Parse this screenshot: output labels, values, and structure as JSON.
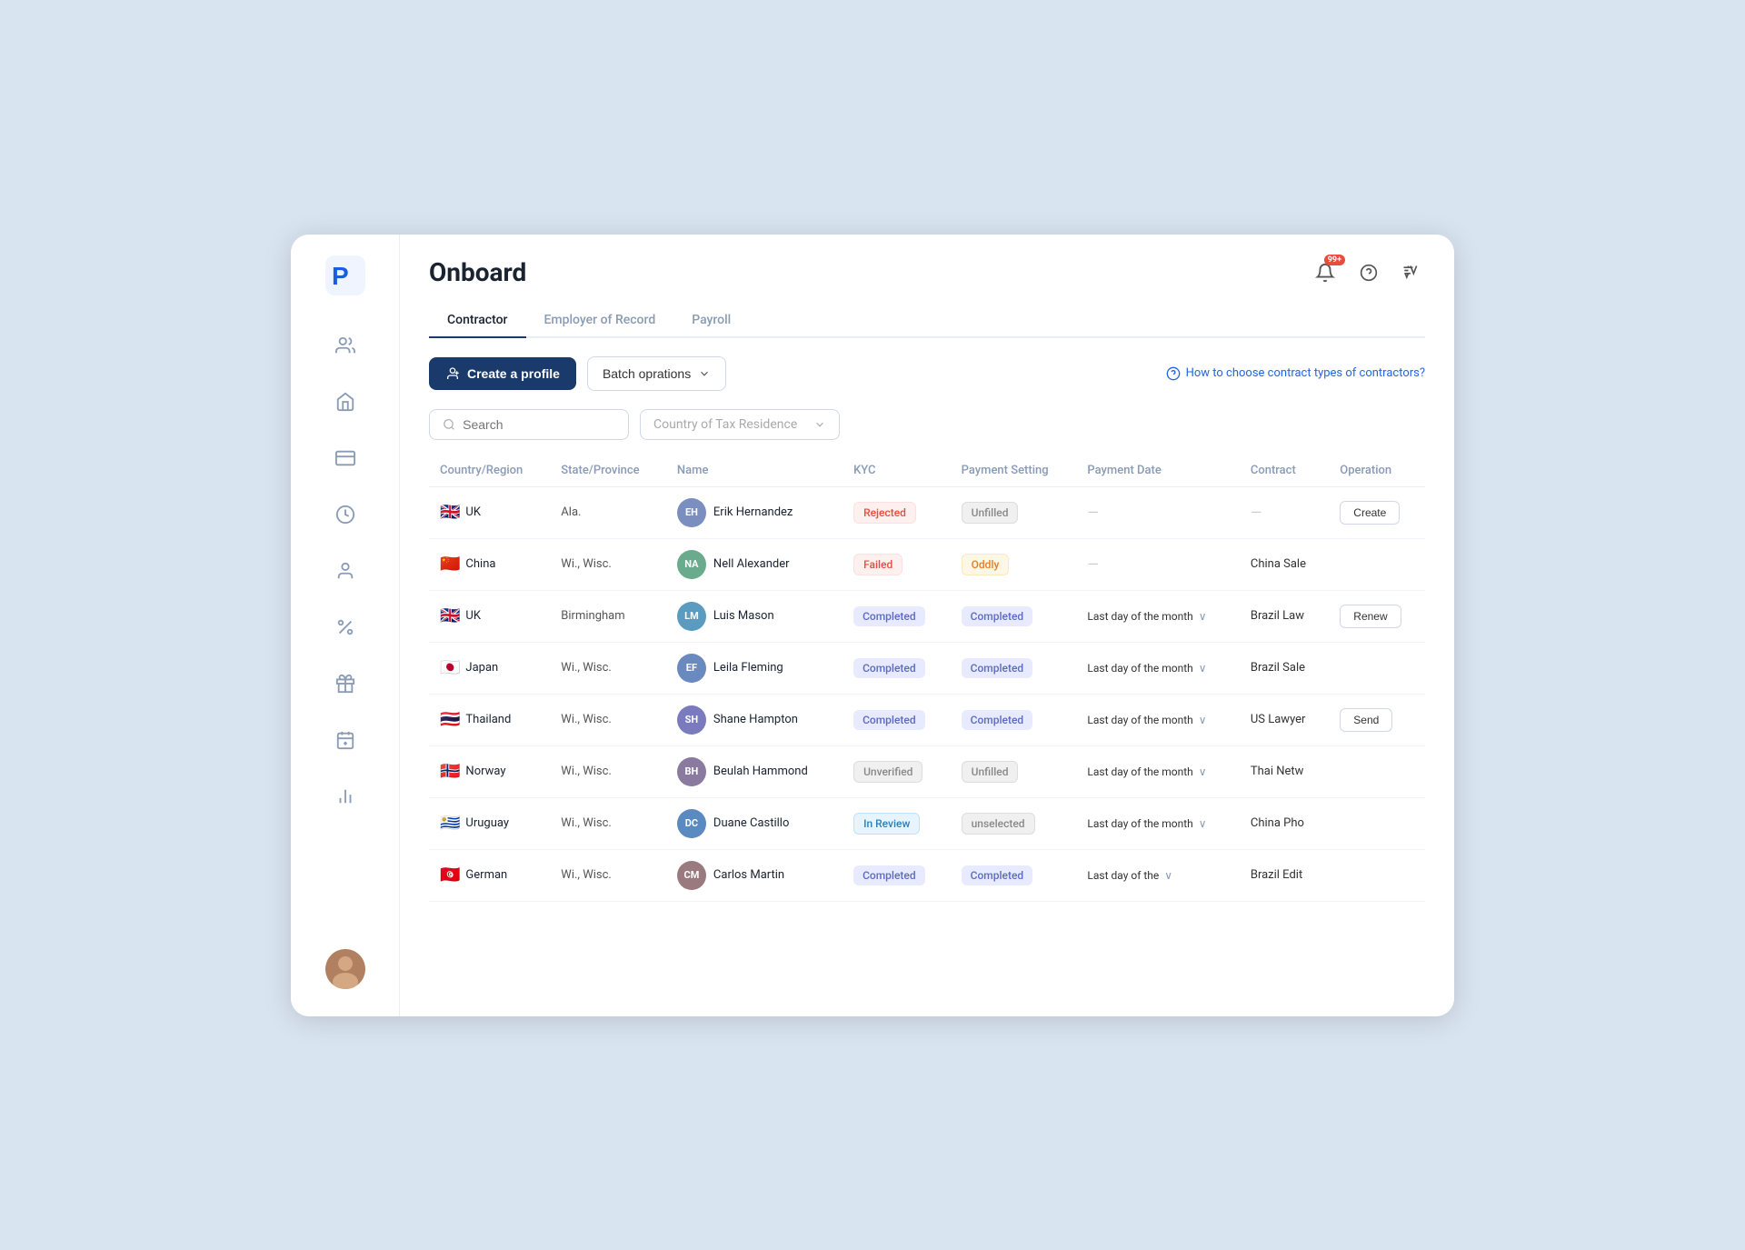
{
  "page": {
    "title": "Onboard",
    "notification_badge": "99+",
    "tabs": [
      {
        "id": "contractor",
        "label": "Contractor",
        "active": true
      },
      {
        "id": "employer",
        "label": "Employer of Record",
        "active": false
      },
      {
        "id": "payroll",
        "label": "Payroll",
        "active": false
      }
    ],
    "toolbar": {
      "create_btn": "Create a profile",
      "batch_btn": "Batch oprations",
      "help_link": "How to choose contract types of contractors?"
    },
    "search_placeholder": "Search",
    "country_filter_placeholder": "Country of Tax Residence",
    "table": {
      "headers": [
        "Country/Region",
        "State/Province",
        "Name",
        "KYC",
        "Payment Setting",
        "Payment Date",
        "Contract",
        "Operation"
      ],
      "rows": [
        {
          "flag": "🇬🇧",
          "country": "UK",
          "state": "Ala.",
          "avatar_initials": "EH",
          "avatar_color": "#7a8fbf",
          "name": "Erik Hernandez",
          "kyc": "Rejected",
          "kyc_type": "rejected",
          "payment_setting": "Unfilled",
          "payment_setting_type": "unfilled",
          "payment_date": "—",
          "payment_date_chevron": false,
          "contract": "—",
          "operation": "Create",
          "operation_type": "button"
        },
        {
          "flag": "🇨🇳",
          "country": "China",
          "state": "Wi., Wisc.",
          "avatar_initials": "NA",
          "avatar_color": "#6aab8e",
          "name": "Nell Alexander",
          "kyc": "Failed",
          "kyc_type": "failed",
          "payment_setting": "Oddly",
          "payment_setting_type": "oddly",
          "payment_date": "—",
          "payment_date_chevron": false,
          "contract": "China Sale",
          "operation": "",
          "operation_type": "none"
        },
        {
          "flag": "🇬🇧",
          "country": "UK",
          "state": "Birmingham",
          "avatar_initials": "LM",
          "avatar_color": "#5b9bbf",
          "name": "Luis Mason",
          "kyc": "Completed",
          "kyc_type": "completed",
          "payment_setting": "Completed",
          "payment_setting_type": "completed",
          "payment_date": "Last day of the month",
          "payment_date_chevron": true,
          "contract": "Brazil Law",
          "operation": "Renew",
          "operation_type": "button"
        },
        {
          "flag": "🇯🇵",
          "country": "Japan",
          "state": "Wi., Wisc.",
          "avatar_initials": "EF",
          "avatar_color": "#6a8abf",
          "name": "Leila Fleming",
          "kyc": "Completed",
          "kyc_type": "completed",
          "payment_setting": "Completed",
          "payment_setting_type": "completed",
          "payment_date": "Last day of the month",
          "payment_date_chevron": true,
          "contract": "Brazil Sale",
          "operation": "",
          "operation_type": "none"
        },
        {
          "flag": "🇹🇭",
          "country": "Thailand",
          "state": "Wi., Wisc.",
          "avatar_initials": "SH",
          "avatar_color": "#7a7abf",
          "name": "Shane Hampton",
          "kyc": "Completed",
          "kyc_type": "completed",
          "payment_setting": "Completed",
          "payment_setting_type": "completed",
          "payment_date": "Last day of the month",
          "payment_date_chevron": true,
          "contract": "US Lawyer",
          "operation": "Send",
          "operation_type": "button"
        },
        {
          "flag": "🇳🇴",
          "country": "Norway",
          "state": "Wi., Wisc.",
          "avatar_initials": "BH",
          "avatar_color": "#8a7a9f",
          "name": "Beulah Hammond",
          "kyc": "Unverified",
          "kyc_type": "unverified",
          "payment_setting": "Unfilled",
          "payment_setting_type": "unfilled",
          "payment_date": "Last day of the month",
          "payment_date_chevron": true,
          "contract": "Thai Netw",
          "operation": "",
          "operation_type": "none"
        },
        {
          "flag": "🇺🇾",
          "country": "Uruguay",
          "state": "Wi., Wisc.",
          "avatar_initials": "DC",
          "avatar_color": "#5a8abf",
          "name": "Duane Castillo",
          "kyc": "In Review",
          "kyc_type": "in-review",
          "payment_setting": "unselected",
          "payment_setting_type": "unselected",
          "payment_date": "Last day of the month",
          "payment_date_chevron": true,
          "contract": "China Pho",
          "operation": "",
          "operation_type": "none"
        },
        {
          "flag": "🇹🇳",
          "country": "German",
          "state": "Wi., Wisc.",
          "avatar_initials": "CM",
          "avatar_color": "#9a7a7f",
          "name": "Carlos Martin",
          "kyc": "Completed",
          "kyc_type": "completed",
          "payment_setting": "Completed",
          "payment_setting_type": "completed",
          "payment_date": "Last day of the",
          "payment_date_chevron": true,
          "contract": "Brazil Edit",
          "operation": "",
          "operation_type": "none"
        }
      ]
    }
  },
  "sidebar": {
    "nav_items": [
      {
        "id": "people",
        "icon": "👥"
      },
      {
        "id": "home",
        "icon": "🏠"
      },
      {
        "id": "card",
        "icon": "💳"
      },
      {
        "id": "clock",
        "icon": "🕐"
      },
      {
        "id": "team",
        "icon": "👤"
      },
      {
        "id": "percent",
        "icon": "%"
      },
      {
        "id": "gift",
        "icon": "🎁"
      },
      {
        "id": "calendar",
        "icon": "📅"
      },
      {
        "id": "chart",
        "icon": "📊"
      }
    ]
  }
}
